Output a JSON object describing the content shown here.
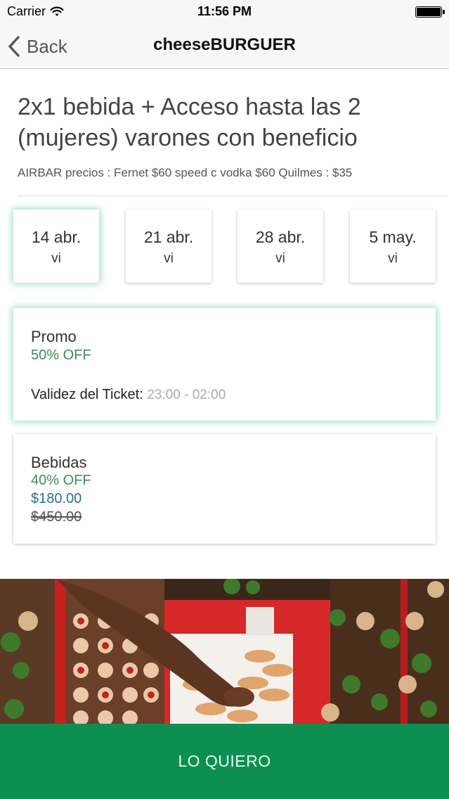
{
  "status_bar": {
    "carrier": "Carrier",
    "time": "11:56 PM",
    "wifi_icon": "wifi-icon",
    "battery_icon": "battery-icon"
  },
  "nav": {
    "back_label": "Back",
    "back_icon": "chevron-left-icon",
    "title": "cheeseBURGUER"
  },
  "event": {
    "title": "2x1 bebida + Acceso hasta las 2 (mujeres) varones con beneficio",
    "subtitle": "AIRBAR precios : Fernet $60 speed c vodka $60 Quilmes : $35"
  },
  "dates": [
    {
      "date": "14 abr.",
      "day": "vi",
      "selected": true
    },
    {
      "date": "21 abr.",
      "day": "vi",
      "selected": false
    },
    {
      "date": "28 abr.",
      "day": "vi",
      "selected": false
    },
    {
      "date": "5 may.",
      "day": "vi",
      "selected": false
    }
  ],
  "tickets": [
    {
      "name": "Promo",
      "discount": "50% OFF",
      "validity_label": "Validez del Ticket:",
      "validity_time": "23:00 - 02:00",
      "selected": true
    },
    {
      "name": "Bebidas",
      "discount": "40% OFF",
      "price": "$180.00",
      "original_price": "$450.00",
      "selected": false
    }
  ],
  "cta": {
    "label": "LO QUIERO"
  },
  "colors": {
    "accent_green": "#0e8f52",
    "discount_green": "#3e8a5e",
    "price_blue": "#2c6f9a",
    "selected_glow": "#50c896"
  }
}
